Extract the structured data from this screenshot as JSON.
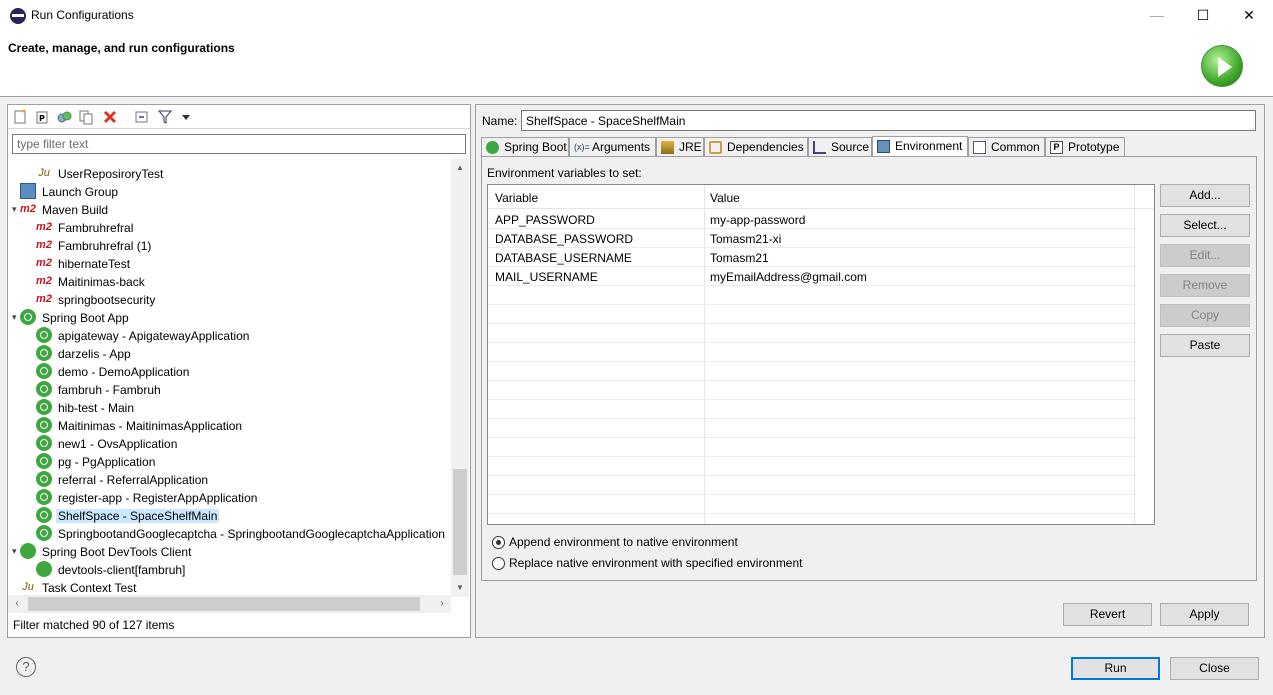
{
  "window": {
    "title": "Run Configurations",
    "minimize_glyph": "—",
    "maximize_glyph": "☐",
    "close_glyph": "✕"
  },
  "header": {
    "heading": "Create, manage, and run configurations"
  },
  "left": {
    "toolbar_icons": [
      "new-configuration-icon",
      "new-prototype-icon",
      "export-icon",
      "duplicate-icon",
      "delete-icon",
      "collapse-all-icon",
      "filter-icon",
      "view-menu-icon"
    ],
    "filter_placeholder": "type filter text",
    "tree": [
      {
        "label": "UserReposiroryTest",
        "icon": "junit-icon",
        "level": 1
      },
      {
        "label": "Launch Group",
        "icon": "launch-group-icon",
        "level": 0
      },
      {
        "label": "Maven Build",
        "icon": "maven-icon",
        "level": 0,
        "expanded": true
      },
      {
        "label": "Fambruhrefral",
        "icon": "maven-icon",
        "level": 1
      },
      {
        "label": "Fambruhrefral (1)",
        "icon": "maven-icon",
        "level": 1
      },
      {
        "label": "hibernateTest",
        "icon": "maven-icon",
        "level": 1
      },
      {
        "label": "Maitinimas-back",
        "icon": "maven-icon",
        "level": 1
      },
      {
        "label": "springbootsecurity",
        "icon": "maven-icon",
        "level": 1
      },
      {
        "label": "Spring Boot App",
        "icon": "spring-boot-icon",
        "level": 0,
        "expanded": true
      },
      {
        "label": "apigateway - ApigatewayApplication",
        "icon": "spring-boot-icon",
        "level": 1
      },
      {
        "label": "darzelis - App",
        "icon": "spring-boot-icon",
        "level": 1
      },
      {
        "label": "demo - DemoApplication",
        "icon": "spring-boot-icon",
        "level": 1
      },
      {
        "label": "fambruh - Fambruh",
        "icon": "spring-boot-icon",
        "level": 1
      },
      {
        "label": "hib-test - Main",
        "icon": "spring-boot-icon",
        "level": 1
      },
      {
        "label": "Maitinimas - MaitinimasApplication",
        "icon": "spring-boot-icon",
        "level": 1
      },
      {
        "label": "new1 - OvsApplication",
        "icon": "spring-boot-icon",
        "level": 1
      },
      {
        "label": "pg - PgApplication",
        "icon": "spring-boot-icon",
        "level": 1
      },
      {
        "label": "referral - ReferralApplication",
        "icon": "spring-boot-icon",
        "level": 1
      },
      {
        "label": "register-app - RegisterAppApplication",
        "icon": "spring-boot-icon",
        "level": 1
      },
      {
        "label": "ShelfSpace - SpaceShelfMain",
        "icon": "spring-boot-icon",
        "level": 1,
        "selected": true
      },
      {
        "label": "SpringbootandGooglecaptcha - SpringbootandGooglecaptchaApplication",
        "icon": "spring-boot-icon",
        "level": 1
      },
      {
        "label": "Spring Boot DevTools Client",
        "icon": "devtools-icon",
        "level": 0,
        "expanded": true
      },
      {
        "label": "devtools-client[fambruh]",
        "icon": "devtools-icon",
        "level": 1
      },
      {
        "label": "Task Context Test",
        "icon": "junit-icon",
        "level": 0
      }
    ],
    "filter_status": "Filter matched 90 of 127 items"
  },
  "right": {
    "name_label": "Name:",
    "name_value": "ShelfSpace - SpaceShelfMain",
    "tabs": [
      {
        "label": "Spring Boot",
        "icon": "spring-boot-icon"
      },
      {
        "label": "Arguments",
        "icon": "arguments-icon"
      },
      {
        "label": "JRE",
        "icon": "jre-icon"
      },
      {
        "label": "Dependencies",
        "icon": "dependencies-icon"
      },
      {
        "label": "Source",
        "icon": "source-icon"
      },
      {
        "label": "Environment",
        "icon": "environment-icon",
        "active": true
      },
      {
        "label": "Common",
        "icon": "common-icon"
      },
      {
        "label": "Prototype",
        "icon": "prototype-icon"
      }
    ],
    "env_label": "Environment variables to set:",
    "table": {
      "headers": [
        "Variable",
        "Value"
      ],
      "rows": [
        {
          "variable": "APP_PASSWORD",
          "value": "my-app-password"
        },
        {
          "variable": "DATABASE_PASSWORD",
          "value": "Tomasm21-xi"
        },
        {
          "variable": "DATABASE_USERNAME",
          "value": "Tomasm21"
        },
        {
          "variable": "MAIL_USERNAME",
          "value": "myEmailAddress@gmail.com"
        }
      ]
    },
    "side_buttons": [
      {
        "label": "Add...",
        "enabled": true
      },
      {
        "label": "Select...",
        "enabled": true
      },
      {
        "label": "Edit...",
        "enabled": false
      },
      {
        "label": "Remove",
        "enabled": false
      },
      {
        "label": "Copy",
        "enabled": false
      },
      {
        "label": "Paste",
        "enabled": true
      }
    ],
    "radio_append": "Append environment to native environment",
    "radio_replace": "Replace native environment with specified environment",
    "revert_label": "Revert",
    "apply_label": "Apply"
  },
  "footer": {
    "help_glyph": "?",
    "run_label": "Run",
    "close_label": "Close"
  }
}
